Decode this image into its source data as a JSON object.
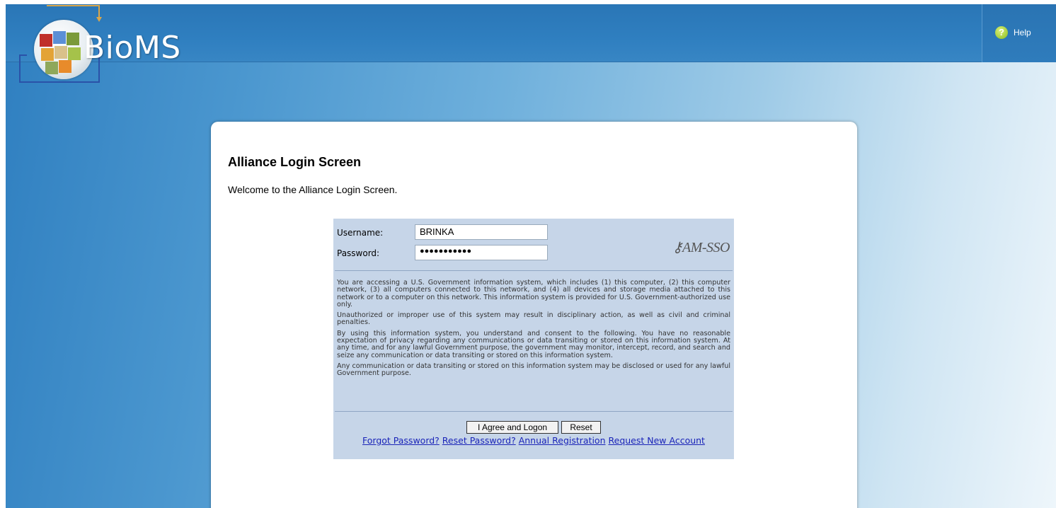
{
  "header": {
    "logo_text": "BioMS",
    "help_label": "Help"
  },
  "panel": {
    "title": "Alliance Login Screen",
    "welcome": "Welcome to the Alliance Login Screen."
  },
  "login": {
    "username_label": "Username:",
    "username_value": "BRINKA",
    "password_label": "Password:",
    "password_value": "●●●●●●●●●●●",
    "brand": "AM-SSO",
    "notice": [
      "You are accessing a U.S. Government information system, which includes (1) this computer, (2) this computer network, (3) all computers connected to this network, and (4) all devices and storage media attached to this network or to a computer on this network. This information system is provided for U.S. Government-authorized use only.",
      "Unauthorized or improper use of this system may result in disciplinary action, as well as civil and criminal penalties.",
      "By using this information system, you understand and consent to the following. You have no reasonable expectation of privacy regarding any communications or data transiting or stored on this information system. At any time, and for any lawful Government purpose, the government may monitor, intercept, record, and search and seize any communication or data transiting or stored on this information system.",
      "Any communication or data transiting or stored on this information system may be disclosed or used for any lawful Government purpose."
    ],
    "agree_button": "I Agree and Logon",
    "reset_button": "Reset",
    "links": {
      "forgot": "Forgot Password?",
      "reset": "Reset Password?",
      "annual": "Annual Registration",
      "request": "Request New Account"
    }
  }
}
